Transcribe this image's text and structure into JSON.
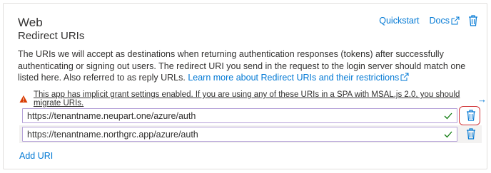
{
  "section": {
    "title": "Web",
    "subtitle": "Redirect URIs",
    "quickstart_label": "Quickstart",
    "docs_label": "Docs",
    "description_text": "The URIs we will accept as destinations when returning authentication responses (tokens) after successfully authenticating or signing out users. The redirect URI you send in the request to the login server should match one listed here. Also referred to as reply URLs. ",
    "learn_more_label": "Learn more about Redirect URIs and their restrictions"
  },
  "warning": {
    "text": "This app has implicit grant settings enabled. If you are using any of these URIs in a SPA with MSAL.js 2.0, you should migrate URIs.",
    "arrow": "→"
  },
  "uris": [
    {
      "value": "https://tenantname.neupart.one/azure/auth"
    },
    {
      "value": "https://tenantname.northgrc.app/azure/auth"
    }
  ],
  "add_uri_label": "Add URI",
  "colors": {
    "link": "#0078d4",
    "warning": "#d83b01",
    "valid_check": "#107c10",
    "highlight": "#d13438"
  },
  "icons": [
    "external-link-icon",
    "trash-icon",
    "warning-icon",
    "checkmark-icon",
    "arrow-right-icon"
  ]
}
